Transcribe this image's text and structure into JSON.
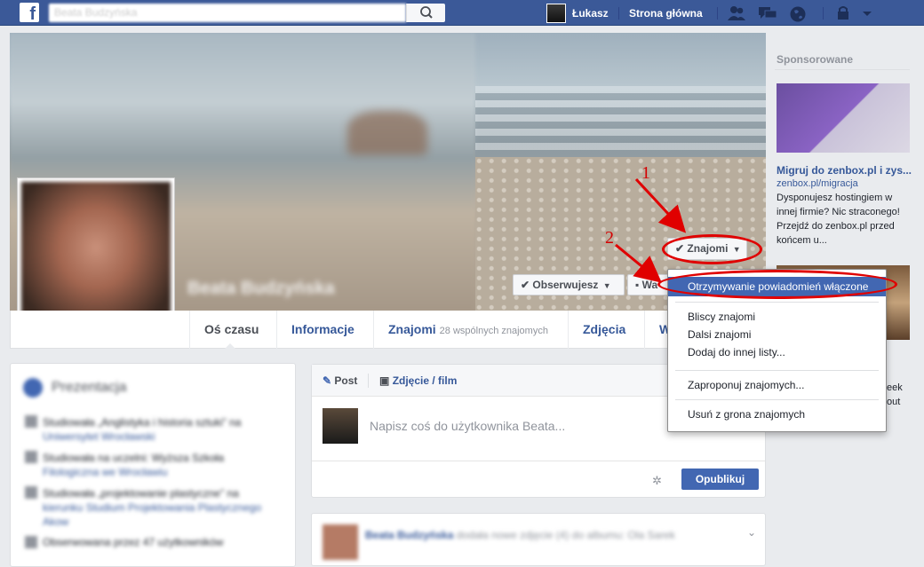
{
  "topbar": {
    "logo": "f",
    "search_placeholder": "Beata Budzyńska",
    "user_name": "Łukasz",
    "home_label": "Strona główna"
  },
  "cover": {
    "profile_name": "Beata Budzyńska",
    "friends_button": "Znajomi",
    "following_button": "Obserwujesz",
    "message_button": "Wa"
  },
  "tabs": {
    "timeline": "Oś czasu",
    "about": "Informacje",
    "friends": "Znajomi",
    "mutual_friends": "28 wspólnych znajomych",
    "photos": "Zdjęcia",
    "more": "W"
  },
  "intro": {
    "title": "Prezentacja",
    "items": [
      {
        "line1": "Studiowała „Anglistyka i historia sztuki” na",
        "line2": "Uniwersytet Wrocławski"
      },
      {
        "line1": "Studiowała na uczelni: Wyższa Szkoła",
        "line2": "Filologiczna we Wrocławiu"
      },
      {
        "line1": "Studiowała „projektowanie plastyczne” na",
        "line2": "kierunku Studium Projektowania Plastycznego",
        "line3": "Akow"
      },
      {
        "line1": "Obserwowana przez 47 użytkowników"
      }
    ]
  },
  "composer": {
    "post_tab": "Post",
    "photo_tab": "Zdjęcie / film",
    "placeholder": "Napisz coś do użytkownika Beata...",
    "publish": "Opublikuj"
  },
  "feed": {
    "author": "Beata Budzyńska",
    "text": "dodała nowe zdjęcie (4) do albumu: Ola Sarek"
  },
  "sidebar": {
    "sponsored": "Sponsorowane",
    "ad_title": "Migruj do zenbox.pl i zys...",
    "ad_url": "zenbox.pl/migracja",
    "ad_text_lines": [
      "Dysponujesz hostingiem w",
      "innej firmie? Nic straconego!",
      "Przejdź do zenbox.pl przed",
      "końcem u..."
    ],
    "ad2_fragments": [
      "eek",
      "out"
    ]
  },
  "menu": {
    "items": [
      "Otrzymywanie powiadomień włączone",
      "Bliscy znajomi",
      "Dalsi znajomi",
      "Dodaj do innej listy...",
      "Zaproponuj znajomych...",
      "Usuń z grona znajomych"
    ]
  },
  "annotations": {
    "num1": "1",
    "num2": "2",
    "annotation_color": "#e00000"
  },
  "colors": {
    "brand": "#3b5998",
    "button_blue": "#4267b2",
    "link": "#365899"
  }
}
